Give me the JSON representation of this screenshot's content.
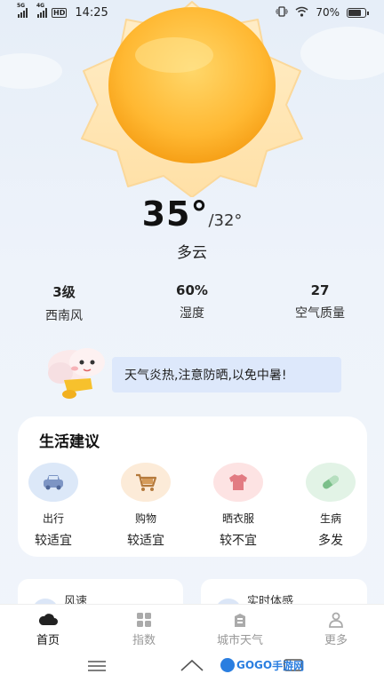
{
  "status": {
    "net1": "5G",
    "net2": "4G",
    "hd": "HD",
    "time": "14:25",
    "battery": "70%"
  },
  "weather": {
    "temp": "35°",
    "low": "/32°",
    "condition": "多云"
  },
  "stats": [
    {
      "value": "3级",
      "label": "西南风"
    },
    {
      "value": "60%",
      "label": "湿度"
    },
    {
      "value": "27",
      "label": "空气质量"
    }
  ],
  "tip": "天气炎热,注意防晒,以免中暑!",
  "advice": {
    "title": "生活建议",
    "items": [
      {
        "name": "出行",
        "status": "较适宜",
        "icon": "car-icon",
        "color": "#dce8f8"
      },
      {
        "name": "购物",
        "status": "较适宜",
        "icon": "cart-icon",
        "color": "#fcebd8"
      },
      {
        "name": "晒衣服",
        "status": "较不宜",
        "icon": "shirt-icon",
        "color": "#fde3e3"
      },
      {
        "name": "生病",
        "status": "多发",
        "icon": "pill-icon",
        "color": "#e2f3e6"
      }
    ]
  },
  "sub_cards": {
    "left": "风速",
    "right": "实时体感"
  },
  "tabs": [
    {
      "label": "首页",
      "icon": "cloud-icon",
      "active": true
    },
    {
      "label": "指数",
      "icon": "grid-icon",
      "active": false
    },
    {
      "label": "城市天气",
      "icon": "building-icon",
      "active": false
    },
    {
      "label": "更多",
      "icon": "user-icon",
      "active": false
    }
  ],
  "watermark": {
    "text1": "GOGO",
    "text2": "手游网"
  }
}
